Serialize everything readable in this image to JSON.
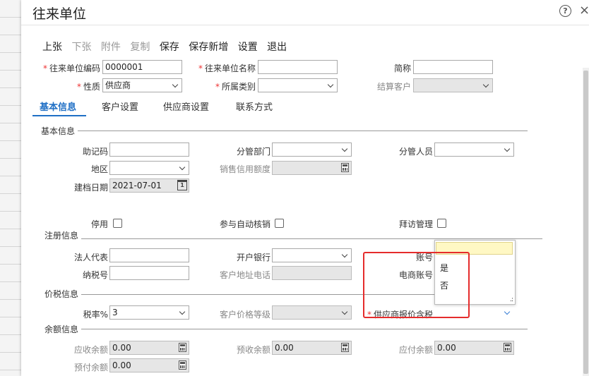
{
  "title": "往来单位",
  "toolbar": {
    "items": [
      {
        "label": "上张",
        "enabled": true
      },
      {
        "label": "下张",
        "enabled": false
      },
      {
        "label": "附件",
        "enabled": false
      },
      {
        "label": "复制",
        "enabled": false
      },
      {
        "label": "保存",
        "enabled": true
      },
      {
        "label": "保存新增",
        "enabled": true
      },
      {
        "label": "设置",
        "enabled": true
      },
      {
        "label": "退出",
        "enabled": true
      }
    ]
  },
  "header": {
    "code_label": "往来单位编码",
    "code_value": "0000001",
    "name_label": "往来单位名称",
    "name_value": "",
    "short_label": "简称",
    "short_value": "",
    "nature_label": "性质",
    "nature_value": "供应商",
    "category_label": "所属类别",
    "category_value": "",
    "settle_label": "结算客户",
    "settle_value": ""
  },
  "tabs": [
    "基本信息",
    "客户设置",
    "供应商设置",
    "联系方式"
  ],
  "basic": {
    "section": "基本信息",
    "mnemonic_label": "助记码",
    "mnemonic_value": "",
    "dept_label": "分管部门",
    "dept_value": "",
    "staff_label": "分管人员",
    "staff_value": "",
    "region_label": "地区",
    "region_value": "",
    "credit_label": "销售信用额度",
    "credit_value": "",
    "date_label": "建档日期",
    "date_value": "2021-07-01",
    "date_icon_text": "1",
    "disable_label": "停用",
    "autoverify_label": "参与自动核销",
    "visit_label": "拜访管理"
  },
  "register": {
    "section": "注册信息",
    "legal_label": "法人代表",
    "legal_value": "",
    "bank_label": "开户银行",
    "bank_value": "",
    "account_label": "账号",
    "taxno_label": "纳税号",
    "taxno_value": "",
    "addr_label": "客户地址电话",
    "addr_value": "",
    "ecom_label": "电商账号"
  },
  "tax": {
    "section": "价税信息",
    "rate_label": "税率%",
    "rate_value": "3",
    "pricelevel_label": "客户价格等级",
    "pricelevel_value": "",
    "supplier_tax_label": "供应商报价含税",
    "supplier_tax_value": ""
  },
  "dropdown": {
    "options": [
      "是",
      "否"
    ]
  },
  "balance": {
    "section": "余额信息",
    "receivable_label": "应收余额",
    "receivable_value": "0.00",
    "prereceive_label": "预收余额",
    "prereceive_value": "0.00",
    "payable_label": "应付余额",
    "payable_value": "0.00",
    "prepay_label": "预付余额",
    "prepay_value": "0.00"
  },
  "colors": {
    "accent": "#1f6fc5",
    "required": "#e33333",
    "highlight_box": "#e52c2c"
  }
}
